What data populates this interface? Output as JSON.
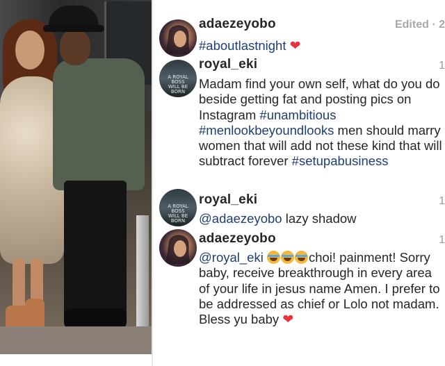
{
  "photo": {
    "alt_label": ""
  },
  "colors": {
    "username": "#262626",
    "hashtag": "#1f3f73",
    "meta": "#9a9a9a",
    "heart": "#e8323c"
  },
  "comments": [
    {
      "username": "adaezeyobo",
      "meta": "Edited · 2",
      "avatar_icon": "profile-photo",
      "text_parts": [
        {
          "type": "tag",
          "text": "#aboutlastnight"
        },
        {
          "type": "text",
          "text": " "
        },
        {
          "type": "heart",
          "text": "❤"
        }
      ]
    },
    {
      "username": "royal_eki",
      "meta": "1",
      "avatar_icon": "profile-photo",
      "avatar_text": "A ROYAL BOSS WILL BE BORN",
      "text_parts": [
        {
          "type": "text",
          "text": "Madam find your own self, what do you do beside getting fat and posting pics on Instagram "
        },
        {
          "type": "tag",
          "text": "#unambitious"
        },
        {
          "type": "text",
          "text": " "
        },
        {
          "type": "tag",
          "text": "#menlookbeyoundlooks"
        },
        {
          "type": "text",
          "text": " men should marry women that will add not these kind that will subtract forever "
        },
        {
          "type": "tag",
          "text": "#setupabusiness"
        }
      ]
    },
    {
      "username": "royal_eki",
      "meta": "1",
      "avatar_icon": "profile-photo",
      "avatar_text": "A ROYAL BOSS WILL BE BORN",
      "text_parts": [
        {
          "type": "mention",
          "text": "@adaezeyobo"
        },
        {
          "type": "text",
          "text": " lazy shadow"
        }
      ]
    },
    {
      "username": "adaezeyobo",
      "meta": "1",
      "avatar_icon": "profile-photo",
      "text_parts": [
        {
          "type": "mention",
          "text": "@royal_eki"
        },
        {
          "type": "text",
          "text": " "
        },
        {
          "type": "emoji",
          "text": "😂"
        },
        {
          "type": "emoji",
          "text": "😂"
        },
        {
          "type": "emoji",
          "text": "😂"
        },
        {
          "type": "text",
          "text": "choi! painment! Sorry baby, receive breakthrough in every area of your life in jesus name Amen. I prefer to be addressed as chief or Lolo not madam. Bless yu baby "
        },
        {
          "type": "heart",
          "text": "❤"
        }
      ]
    }
  ]
}
